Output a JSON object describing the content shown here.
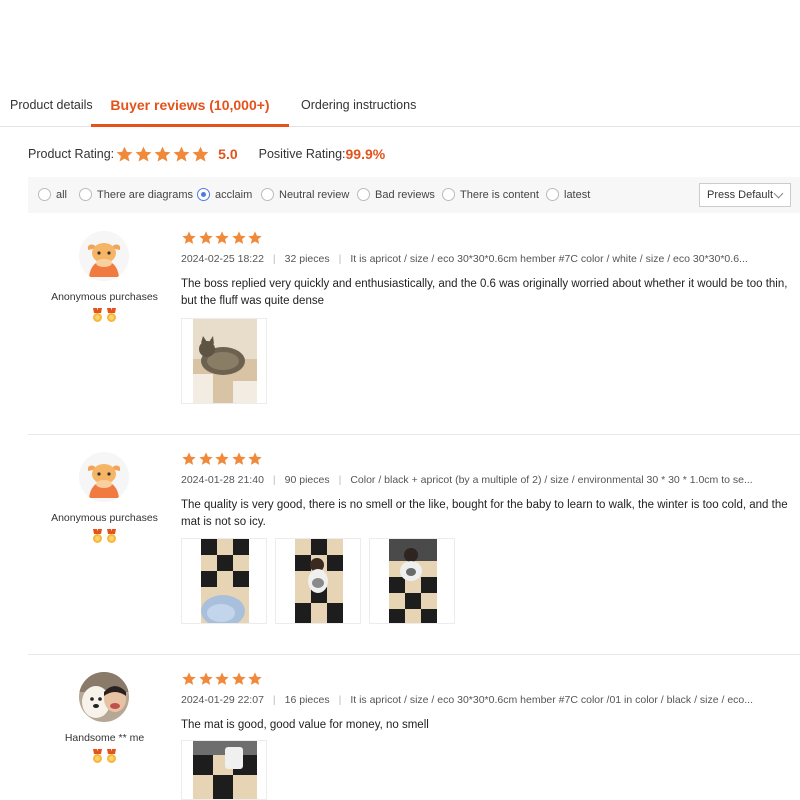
{
  "tabs": [
    {
      "label": "Product details"
    },
    {
      "label": "Buyer reviews (10,000+)"
    },
    {
      "label": "Ordering instructions"
    }
  ],
  "summary": {
    "rating_label": "Product Rating:",
    "score": "5.0",
    "positive_label": "Positive Rating:",
    "positive_value": "99.9%",
    "stars": 5
  },
  "filters": {
    "options": [
      {
        "label": "all",
        "checked": false
      },
      {
        "label": "There are diagrams",
        "checked": false
      },
      {
        "label": "acclaim",
        "checked": true
      },
      {
        "label": "Neutral review",
        "checked": false
      },
      {
        "label": "Bad reviews",
        "checked": false
      },
      {
        "label": "There is content",
        "checked": false
      },
      {
        "label": "latest",
        "checked": false
      }
    ],
    "sort_label": "Press Default"
  },
  "reviews": [
    {
      "user": "Anonymous purchases",
      "avatar": "cow-avatar",
      "stars": 5,
      "date": "2024-02-25 18:22",
      "qty": "32 pieces",
      "spec": "It is apricot / size / eco 30*30*0.6cm hember #7C color / white / size / eco 30*30*0.6...",
      "text": "The boss replied very quickly and enthusiastically, and the 0.6 was originally worried about whether it would be too thin, but the fluff was quite dense",
      "photos": [
        "cat-on-mat-photo"
      ]
    },
    {
      "user": "Anonymous purchases",
      "avatar": "cow-avatar",
      "stars": 5,
      "date": "2024-01-28 21:40",
      "qty": "90 pieces",
      "spec": "Color / black + apricot (by a multiple of 2) / size / environmental 30 * 30 * 1.0cm to se...",
      "text": "The quality is very good, there is no smell or the like, bought for the baby to learn to walk, the winter is too cold, and the mat is not so icy.",
      "photos": [
        "checkered-mat-photo",
        "baby-on-mat-photo",
        "baby-sitting-photo"
      ]
    },
    {
      "user": "Handsome ** me",
      "avatar": "dog-photo-avatar",
      "stars": 5,
      "date": "2024-01-29 22:07",
      "qty": "16 pieces",
      "spec": "It is apricot / size / eco 30*30*0.6cm hember #7C color /01 in color / black / size / eco...",
      "text": "The mat is good, good value for money, no smell",
      "photos": [
        "mat-corner-photo"
      ]
    }
  ],
  "colors": {
    "accent": "#e4531c",
    "star": "#f08a3a",
    "radio": "#4d7be3"
  }
}
